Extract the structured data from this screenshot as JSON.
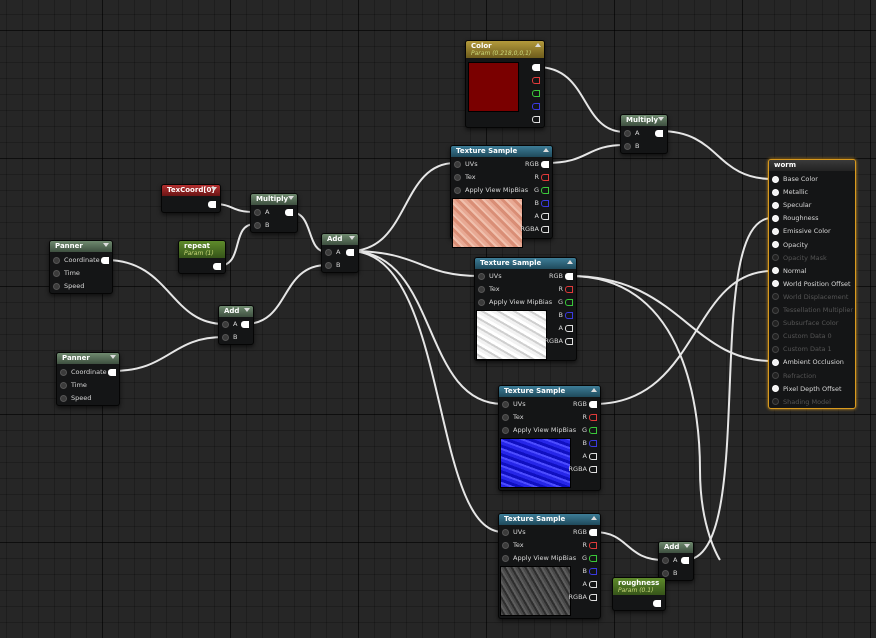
{
  "colors": {
    "grid_bg": "#262626",
    "wire": "#e6e6e6",
    "header_green": "#4e6650",
    "header_teal": "#2b6179",
    "header_red": "#962222",
    "header_olive": "#4a7023",
    "header_gold": "#8d7a2a",
    "output_border": "#d99a1f",
    "color_preview": "#7a0000"
  },
  "nodes": {
    "color": {
      "title": "Color",
      "subtitle": "Param (0.218,0,0,1)"
    },
    "multiply_top": {
      "title": "Multiply",
      "pins": [
        "A",
        "B"
      ]
    },
    "tex_sample_1": {
      "title": "Texture Sample",
      "inputs": [
        "UVs",
        "Tex",
        "Apply View MipBias"
      ],
      "outputs": [
        "RGB",
        "R",
        "G",
        "B",
        "A",
        "RGBA"
      ]
    },
    "tex_sample_2": {
      "title": "Texture Sample",
      "inputs": [
        "UVs",
        "Tex",
        "Apply View MipBias"
      ],
      "outputs": [
        "RGB",
        "R",
        "G",
        "B",
        "A",
        "RGBA"
      ]
    },
    "tex_sample_3": {
      "title": "Texture Sample",
      "inputs": [
        "UVs",
        "Tex",
        "Apply View MipBias"
      ],
      "outputs": [
        "RGB",
        "R",
        "G",
        "B",
        "A",
        "RGBA"
      ]
    },
    "tex_sample_4": {
      "title": "Texture Sample",
      "inputs": [
        "UVs",
        "Tex",
        "Apply View MipBias"
      ],
      "outputs": [
        "RGB",
        "R",
        "G",
        "B",
        "A",
        "RGBA"
      ]
    },
    "texcoord": {
      "title": "TexCoord[0]"
    },
    "multiply_mid": {
      "title": "Multiply",
      "pins": [
        "A",
        "B"
      ]
    },
    "repeat": {
      "title": "repeat",
      "subtitle": "Param (1)"
    },
    "add_center": {
      "title": "Add",
      "pins": [
        "A",
        "B"
      ]
    },
    "panner_1": {
      "title": "Panner",
      "inputs": [
        "Coordinate",
        "Time",
        "Speed"
      ]
    },
    "panner_2": {
      "title": "Panner",
      "inputs": [
        "Coordinate",
        "Time",
        "Speed"
      ]
    },
    "add_lower": {
      "title": "Add",
      "pins": [
        "A",
        "B"
      ]
    },
    "add_right": {
      "title": "Add",
      "pins": [
        "A",
        "B"
      ]
    },
    "roughness": {
      "title": "roughness",
      "subtitle": "Param (0.1)"
    },
    "output": {
      "title": "worm",
      "pins": [
        "Base Color",
        "Metallic",
        "Specular",
        "Roughness",
        "Emissive Color",
        "Opacity",
        "Opacity Mask",
        "Normal",
        "World Position Offset",
        "World Displacement",
        "Tessellation Multiplier",
        "Subsurface Color",
        "Custom Data 0",
        "Custom Data 1",
        "Ambient Occlusion",
        "Refraction",
        "Pixel Depth Offset",
        "Shading Model"
      ],
      "disabled": [
        "Opacity Mask",
        "World Displacement",
        "Tessellation Multiplier",
        "Subsurface Color",
        "Custom Data 0",
        "Custom Data 1",
        "Refraction",
        "Shading Model"
      ]
    }
  }
}
